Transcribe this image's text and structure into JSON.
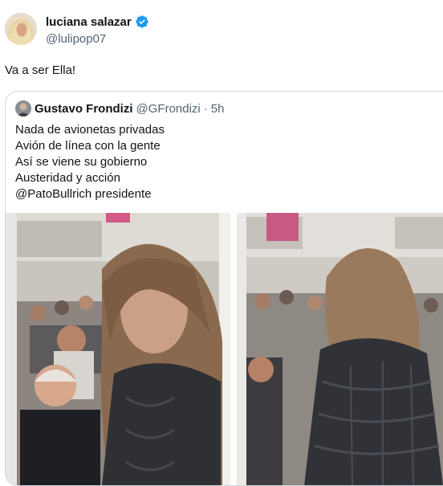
{
  "author": {
    "display_name": "luciana salazar",
    "handle": "@lulipop07",
    "verified_icon": "verified-badge-icon",
    "badge_color": "#1d9bf0"
  },
  "tweet": {
    "text": "Va a ser Ella!"
  },
  "quoted_tweet": {
    "display_name": "Gustavo Frondizi",
    "handle": "@GFrondizi",
    "separator": "·",
    "time": "5h",
    "lines": [
      "Nada de avionetas privadas",
      "Avión de línea con la gente",
      "Así se viene su gobierno",
      "Austeridad y acción",
      "@PatoBullrich presidente"
    ],
    "media": [
      "airplane-cabin-photo-left",
      "airplane-cabin-photo-right"
    ]
  },
  "colors": {
    "text": "#0f1419",
    "secondary": "#536471",
    "border": "#cfd9de",
    "accent": "#1d9bf0"
  }
}
